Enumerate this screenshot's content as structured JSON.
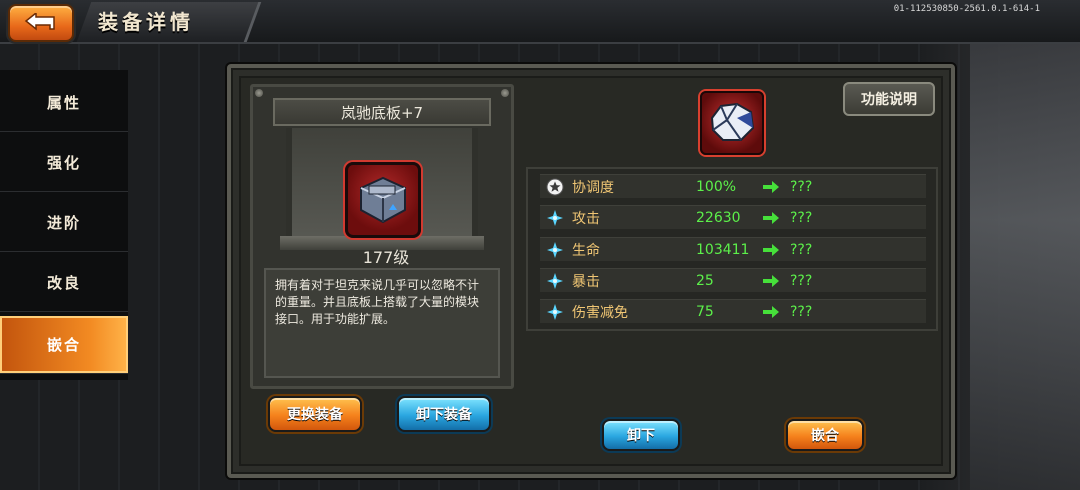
{
  "header": {
    "title": "装备详情",
    "build_id": "01-112530850-2561.0.1-614-1"
  },
  "sidebar": {
    "items": [
      {
        "label": "属性",
        "active": false
      },
      {
        "label": "强化",
        "active": false
      },
      {
        "label": "进阶",
        "active": false
      },
      {
        "label": "改良",
        "active": false
      },
      {
        "label": "嵌合",
        "active": true
      }
    ]
  },
  "equipment": {
    "name": "岚驰底板+7",
    "level": "177级",
    "description": "拥有着对于坦克来说几乎可以忽略不计的重量。并且底板上搭载了大量的模块接口。用于功能扩展。",
    "replace_label": "更换装备",
    "unequip_label": "卸下装备"
  },
  "inlay": {
    "help_label": "功能说明",
    "stats": [
      {
        "name": "协调度",
        "value": "100%",
        "next": "???",
        "icon": "star-icon"
      },
      {
        "name": "攻击",
        "value": "22630",
        "next": "???",
        "icon": "diamond-icon"
      },
      {
        "name": "生命",
        "value": "103411",
        "next": "???",
        "icon": "diamond-icon"
      },
      {
        "name": "暴击",
        "value": "25",
        "next": "???",
        "icon": "diamond-icon"
      },
      {
        "name": "伤害减免",
        "value": "75",
        "next": "???",
        "icon": "diamond-icon"
      }
    ],
    "remove_label": "卸下",
    "inlay_label": "嵌合"
  },
  "colors": {
    "accent_orange": "#f5811c",
    "accent_blue": "#2aa6e0",
    "stat_name": "#f0c674",
    "stat_value": "#5cf04a"
  }
}
